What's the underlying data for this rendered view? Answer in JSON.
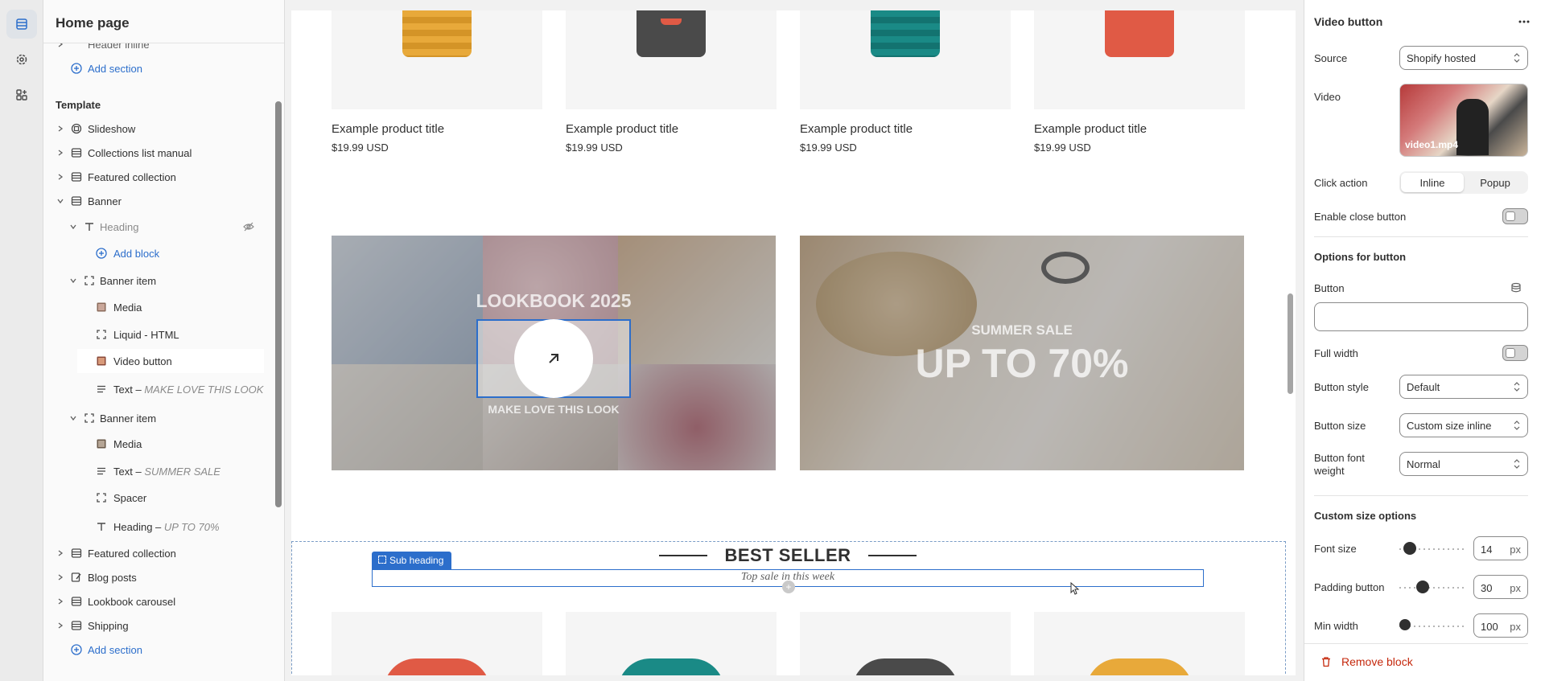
{
  "sidebar": {
    "title": "Home page",
    "header_inline": "Header inline",
    "add_section_top": "Add section",
    "template_label": "Template",
    "items": [
      {
        "label": "Slideshow"
      },
      {
        "label": "Collections list manual"
      },
      {
        "label": "Featured collection"
      },
      {
        "label": "Banner"
      },
      {
        "label": "Heading"
      },
      {
        "label": "Add block"
      },
      {
        "label": "Banner item"
      },
      {
        "label": "Media"
      },
      {
        "label": "Liquid - HTML"
      },
      {
        "label": "Video button"
      },
      {
        "label": "Text",
        "suffix": "MAKE LOVE THIS LOOK"
      },
      {
        "label": "Banner item"
      },
      {
        "label": "Media"
      },
      {
        "label": "Text",
        "suffix": "SUMMER SALE"
      },
      {
        "label": "Spacer"
      },
      {
        "label": "Heading",
        "suffix": "UP TO 70%"
      },
      {
        "label": "Featured collection"
      },
      {
        "label": "Blog posts"
      },
      {
        "label": "Lookbook carousel"
      },
      {
        "label": "Shipping"
      }
    ],
    "add_section_bottom": "Add section"
  },
  "preview": {
    "products_top": [
      {
        "title": "Example product title",
        "price": "$19.99 USD",
        "color": "#e8a93a"
      },
      {
        "title": "Example product title",
        "price": "$19.99 USD",
        "color": "#4a4a4a"
      },
      {
        "title": "Example product title",
        "price": "$19.99 USD",
        "color": "#1a8a86"
      },
      {
        "title": "Example product title",
        "price": "$19.99 USD",
        "color": "#e05a45"
      }
    ],
    "banner_left": {
      "heading": "LOOKBOOK 2025",
      "caption": "MAKE LOVE THIS LOOK"
    },
    "banner_right": {
      "subheading": "SUMMER SALE",
      "heading": "UP TO 70%"
    },
    "best_seller": {
      "title": "BEST SELLER",
      "subtitle": "Top sale in this week",
      "tag": "Sub heading"
    },
    "products_bottom": [
      {
        "color": "#e05a45"
      },
      {
        "color": "#1a8a86"
      },
      {
        "color": "#4a4a4a"
      },
      {
        "color": "#e8a93a"
      }
    ]
  },
  "panel": {
    "title": "Video button",
    "source_label": "Source",
    "source_value": "Shopify hosted",
    "video_label": "Video",
    "video_file": "video1.mp4",
    "click_action_label": "Click action",
    "click_action_options": [
      "Inline",
      "Popup"
    ],
    "click_action_selected": "Inline",
    "enable_close_label": "Enable close button",
    "enable_close_on": false,
    "options_heading": "Options for button",
    "button_label": "Button",
    "button_value": "",
    "full_width_label": "Full width",
    "full_width_on": false,
    "button_style_label": "Button style",
    "button_style_value": "Default",
    "button_size_label": "Button size",
    "button_size_value": "Custom size inline",
    "button_weight_label_1": "Button font",
    "button_weight_label_2": "weight",
    "button_weight_value": "Normal",
    "custom_heading": "Custom size options",
    "font_size_label": "Font size",
    "font_size_value": "14",
    "padding_label": "Padding button",
    "padding_value": "30",
    "min_width_label": "Min width",
    "min_width_value": "100",
    "unit": "px",
    "remove_label": "Remove block"
  }
}
